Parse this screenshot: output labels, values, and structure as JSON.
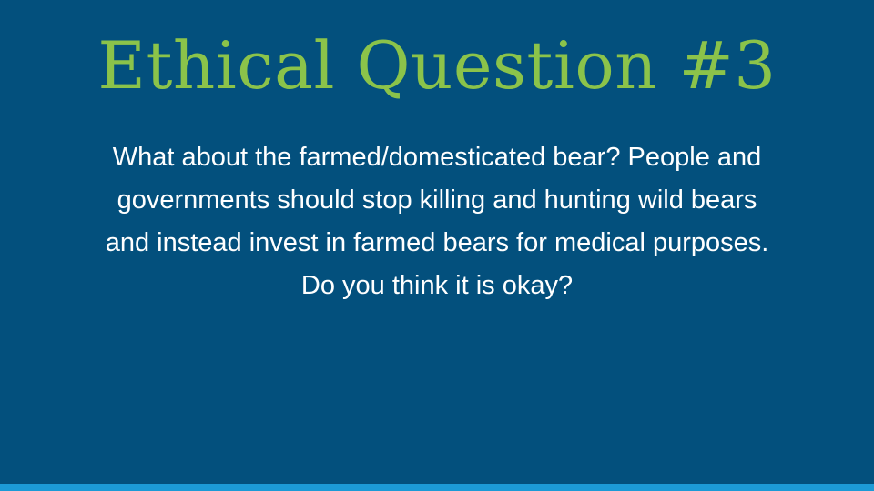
{
  "slide": {
    "title": "Ethical Question #3",
    "body_lines": [
      "What about the farmed/domesticated bear? People and",
      "governments should stop killing and hunting wild bears",
      "and instead invest in farmed bears for medical purposes.",
      "Do you think it is okay?"
    ]
  },
  "colors": {
    "background": "#03507d",
    "title": "#8bc34a",
    "body_text": "#ffffff",
    "bottom_bar": "#1c9ad6"
  }
}
